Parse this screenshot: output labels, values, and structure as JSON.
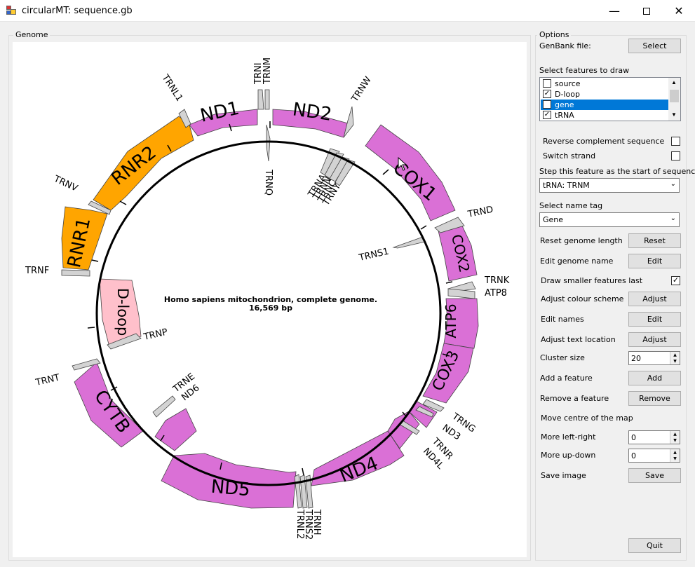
{
  "window": {
    "title": "circularMT: sequence.gb"
  },
  "genome_group": {
    "title": "Genome"
  },
  "map": {
    "name": "Homo sapiens mitochondrion, complete genome.",
    "length": "16,569 bp",
    "gene_labels": {
      "nd1": "ND1",
      "nd2": "ND2",
      "cox1": "COX1",
      "cox2": "COX2",
      "atp6": "ATP6",
      "cox3": "COX3",
      "nd4": "ND4",
      "nd5": "ND5",
      "cytb": "CYTB",
      "rnr1": "RNR1",
      "rnr2": "RNR2",
      "dloop": "D-loop",
      "nd6": "ND6"
    },
    "trna_labels": {
      "trnl1": "TRNL1",
      "trni": "TRNI",
      "trnm": "TRNM",
      "trnq": "TRNQ",
      "trnw": "TRNW",
      "trna": "TRNA",
      "trnn": "TRNN",
      "trnc": "TRNC",
      "trny": "TRNY",
      "trnd": "TRND",
      "trns1": "TRNS1",
      "trnk": "TRNK",
      "atp8": "ATP8",
      "trng": "TRNG",
      "nd3": "ND3",
      "trnr": "TRNR",
      "nd4l": "ND4L",
      "trnh": "TRNH",
      "trns2": "TRNS2",
      "trnl2": "TRNL2",
      "trne": "TRNE",
      "nd6_small": "ND6",
      "trnt": "TRNT",
      "trnp": "TRNP",
      "trnv": "TRNV",
      "trnf": "TRNF"
    },
    "colors": {
      "gene": "#da70d6",
      "rrna": "#ffa500",
      "dloop": "#ffc0cb",
      "trna": "#d3d3d3"
    }
  },
  "options": {
    "title": "Options",
    "genbank_label": "GenBank file:",
    "select_button": "Select",
    "features_label": "Select features to draw",
    "features": [
      {
        "label": "source",
        "checked": ""
      },
      {
        "label": "D-loop",
        "checked": "✓"
      },
      {
        "label": "gene",
        "checked": ""
      },
      {
        "label": "tRNA",
        "checked": "✓"
      }
    ],
    "reverse_label": "Reverse complement sequence",
    "switch_label": "Switch strand",
    "start_label": "Step this feature as the start of sequence.",
    "start_value": "tRNA: TRNM",
    "name_tag_label": "Select name tag",
    "name_tag_value": "Gene",
    "reset_label": "Reset genome length",
    "reset_button": "Reset",
    "edit_genome_label": "Edit genome name",
    "edit_button": "Edit",
    "smaller_label": "Draw smaller features last",
    "smaller_checked": "✓",
    "colour_label": "Adjust colour scheme",
    "adjust_button": "Adjust",
    "edit_names_label": "Edit names",
    "text_loc_label": "Adjust text location",
    "cluster_label": "Cluster size",
    "cluster_value": "20",
    "add_label": "Add a feature",
    "add_button": "Add",
    "remove_label": "Remove a feature",
    "remove_button": "Remove",
    "move_label": "Move centre of the map",
    "lr_label": "More left-right",
    "lr_value": "0",
    "ud_label": "More up-down",
    "ud_value": "0",
    "save_label": "Save image",
    "save_button": "Save",
    "quit_button": "Quit"
  }
}
